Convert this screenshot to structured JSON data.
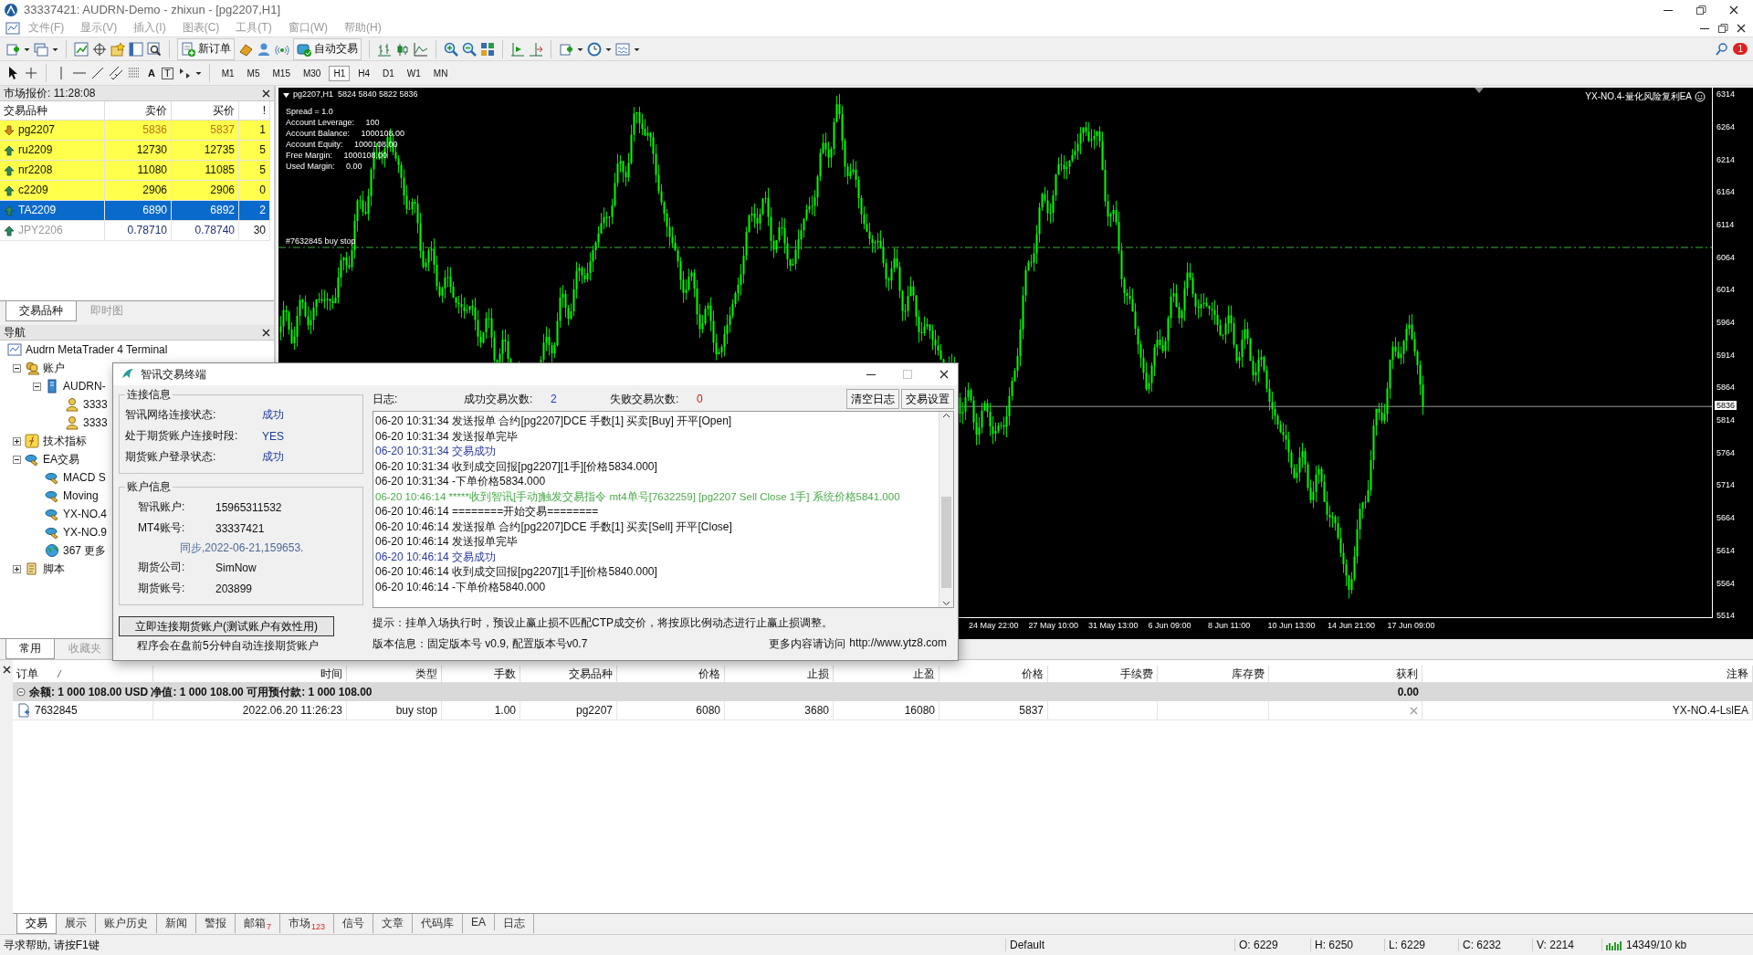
{
  "window": {
    "title": "33337421: AUDRN-Demo - zhixun - [pg2207,H1]"
  },
  "menu": [
    "文件(F)",
    "显示(V)",
    "插入(I)",
    "图表(C)",
    "工具(T)",
    "窗口(W)",
    "帮助(H)"
  ],
  "toolbar": {
    "new_order": "新订单",
    "auto_trade": "自动交易",
    "text_tool": "A",
    "label_tool": "T",
    "notifications": "1",
    "timeframes": [
      {
        "label": "M1",
        "selected": false
      },
      {
        "label": "M5",
        "selected": false
      },
      {
        "label": "M15",
        "selected": false
      },
      {
        "label": "M30",
        "selected": false
      },
      {
        "label": "H1",
        "selected": true
      },
      {
        "label": "H4",
        "selected": false
      },
      {
        "label": "D1",
        "selected": false
      },
      {
        "label": "W1",
        "selected": false
      },
      {
        "label": "MN",
        "selected": false
      }
    ]
  },
  "market_watch": {
    "title": "市场报价: 11:28:08",
    "columns": [
      "交易品种",
      "卖价",
      "买价",
      "!"
    ],
    "rows": [
      {
        "symbol": "pg2207",
        "bid": "5836",
        "ask": "5837",
        "spread": "1",
        "falling": true,
        "highlighted": true,
        "selected": false,
        "dimmed": false
      },
      {
        "symbol": "ru2209",
        "bid": "12730",
        "ask": "12735",
        "spread": "5",
        "falling": false,
        "highlighted": true,
        "selected": false,
        "dimmed": false
      },
      {
        "symbol": "nr2208",
        "bid": "11080",
        "ask": "11085",
        "spread": "5",
        "falling": false,
        "highlighted": true,
        "selected": false,
        "dimmed": false
      },
      {
        "symbol": "c2209",
        "bid": "2906",
        "ask": "2906",
        "spread": "0",
        "falling": false,
        "highlighted": true,
        "selected": false,
        "dimmed": false
      },
      {
        "symbol": "TA2209",
        "bid": "6890",
        "ask": "6892",
        "spread": "2",
        "falling": false,
        "highlighted": false,
        "selected": true,
        "dimmed": false
      },
      {
        "symbol": "JPY2206",
        "bid": "0.78710",
        "ask": "0.78740",
        "spread": "30",
        "falling": false,
        "highlighted": false,
        "selected": false,
        "dimmed": true
      }
    ],
    "tabs": [
      {
        "label": "交易品种",
        "selected": true
      },
      {
        "label": "即时图",
        "selected": false
      }
    ]
  },
  "navigator": {
    "title": "导航",
    "tree": {
      "label": "Audrn MetaTrader 4 Terminal",
      "kind": "terminal",
      "children": [
        {
          "label": "账户",
          "kind": "accounts",
          "expanded": true,
          "children": [
            {
              "label": "AUDRN-",
              "kind": "server",
              "expanded": true,
              "children": [
                {
                  "label": "3333",
                  "kind": "account"
                },
                {
                  "label": "3333",
                  "kind": "account"
                }
              ]
            }
          ]
        },
        {
          "label": "技术指标",
          "kind": "indicators",
          "expanded": false
        },
        {
          "label": "EA交易",
          "kind": "experts",
          "expanded": true,
          "children": [
            {
              "label": "MACD S",
              "kind": "expert"
            },
            {
              "label": "Moving",
              "kind": "expert"
            },
            {
              "label": "YX-NO.4",
              "kind": "expert"
            },
            {
              "label": "YX-NO.9",
              "kind": "expert"
            },
            {
              "label": "367 更多",
              "kind": "more"
            }
          ]
        },
        {
          "label": "脚本",
          "kind": "scripts",
          "expanded": false
        }
      ]
    },
    "tabs": [
      {
        "label": "常用",
        "selected": true
      },
      {
        "label": "收藏夹",
        "selected": false
      }
    ]
  },
  "chart": {
    "header": "pg2207,H1  5824 5840 5822 5836",
    "info_lines": [
      "Spread = 1.0",
      "Account Leverage:     100",
      "Account Balance:     1000108.00",
      "Account Equity:     1000108.00",
      "Free Margin:     1000108.00",
      "Used Margin:     0.00"
    ],
    "ea_label": "YX-NO.4-量化风险复利EA",
    "order_label": "#7632845 buy stop",
    "price_ticks": [
      "6314",
      "6264",
      "6214",
      "6164",
      "6114",
      "6064",
      "6014",
      "5964",
      "5914",
      "5864",
      "5814",
      "5764",
      "5714",
      "5664",
      "5614",
      "5564",
      "5514"
    ],
    "current_price": "5836",
    "time_labels": [
      "24 May 22:00",
      "27 May 10:00",
      "31 May 13:00",
      "6 Jun 09:00",
      "8 Jun 11:00",
      "10 Jun 13:00",
      "14 Jun 21:00",
      "17 Jun 09:00"
    ]
  },
  "dialog": {
    "title": "智讯交易终端",
    "connection": {
      "title": "连接信息",
      "rows": [
        {
          "label": "智讯网络连接状态:",
          "value": "成功"
        },
        {
          "label": "处于期货账户连接时段:",
          "value": "YES"
        },
        {
          "label": "期货账户登录状态:",
          "value": "成功"
        }
      ]
    },
    "account": {
      "title": "账户信息",
      "rows": [
        {
          "kind": "field",
          "label": "智讯账户:",
          "value": "15965311532"
        },
        {
          "kind": "field",
          "label": "MT4账号:",
          "value": "33337421"
        },
        {
          "kind": "note",
          "text": "同步,2022-06-21,159653."
        },
        {
          "kind": "field",
          "label": "期货公司:",
          "value": "SimNow"
        },
        {
          "kind": "field",
          "label": "期货账号:",
          "value": "203899"
        }
      ]
    },
    "connect_button": "立即连接期货账户(测试账户有效性用)",
    "auto_note": "程序会在盘前5分钟自动连接期货账户",
    "log_label": "日志:",
    "stats": [
      {
        "label": "成功交易次数:",
        "value": "2",
        "color": "#1a3ad0"
      },
      {
        "label": "失败交易次数:",
        "value": "0",
        "color": "#e01010"
      }
    ],
    "buttons": [
      "清空日志",
      "交易设置"
    ],
    "log": [
      {
        "kind": "normal",
        "text": "06-20 10:31:34 发送报单 合约[pg2207]DCE 手数[1] 买卖[Buy] 开平[Open]"
      },
      {
        "kind": "normal",
        "text": "06-20 10:31:34 发送报单完毕"
      },
      {
        "kind": "success",
        "text": "06-20 10:31:34 交易成功"
      },
      {
        "kind": "normal",
        "text": "06-20 10:31:34 收到成交回报[pg2207][1手][价格5834.000]"
      },
      {
        "kind": "normal",
        "text": "06-20 10:31:34 -下单价格5834.000"
      },
      {
        "kind": "signal",
        "text": "06-20 10:46:14 *****收到智讯[手动]触发交易指令 mt4单号[7632259] [pg2207 Sell Close 1手] 系统价格5841.000"
      },
      {
        "kind": "normal",
        "text": "06-20 10:46:14 ========开始交易========"
      },
      {
        "kind": "normal",
        "text": "06-20 10:46:14 发送报单 合约[pg2207]DCE 手数[1] 买卖[Sell] 开平[Close]"
      },
      {
        "kind": "normal",
        "text": "06-20 10:46:14 发送报单完毕"
      },
      {
        "kind": "success",
        "text": "06-20 10:46:14 交易成功"
      },
      {
        "kind": "normal",
        "text": "06-20 10:46:14 收到成交回报[pg2207][1手][价格5840.000]"
      },
      {
        "kind": "normal",
        "text": "06-20 10:46:14 -下单价格5840.000"
      }
    ],
    "hint": "提示：挂单入场执行时，预设止赢止损不匹配CTP成交价，将按原比例动态进行止赢止损调整。",
    "version": "版本信息：固定版本号 v0.9, 配置版本号v0.7",
    "more_label": "更多内容请访问",
    "link": "http://www.ytz8.com"
  },
  "terminal": {
    "columns": [
      "订单",
      "时间",
      "类型",
      "手数",
      "交易品种",
      "价格",
      "止损",
      "止盈",
      "价格",
      "手续费",
      "库存费",
      "获利",
      "注释"
    ],
    "balance": "余额: 1 000 108.00 USD  净值: 1 000 108.00  可用预付款: 1 000 108.00",
    "balance_profit": "0.00",
    "orders": [
      {
        "ticket": "7632845",
        "time": "2022.06.20 11:26:23",
        "type": "buy stop",
        "lots": "1.00",
        "symbol": "pg2207",
        "price": "6080",
        "sl": "3680",
        "tp": "16080",
        "current": "5837",
        "comment": "YX-NO.4-LslEA"
      }
    ],
    "tabs": [
      {
        "label": "交易",
        "selected": true
      },
      {
        "label": "展示",
        "selected": false
      },
      {
        "label": "账户历史",
        "selected": false
      },
      {
        "label": "新闻",
        "selected": false
      },
      {
        "label": "警报",
        "selected": false
      },
      {
        "label": "邮箱",
        "badge": "7",
        "selected": false
      },
      {
        "label": "市场",
        "badge": "123",
        "selected": false
      },
      {
        "label": "信号",
        "selected": false
      },
      {
        "label": "文章",
        "selected": false
      },
      {
        "label": "代码库",
        "selected": false
      },
      {
        "label": "EA",
        "selected": false
      },
      {
        "label": "日志",
        "selected": false
      }
    ]
  },
  "status_bar": {
    "help": "寻求帮助, 请按F1键",
    "profile": "Default",
    "ohlcv": [
      "O: 6229",
      "H: 6250",
      "L: 6229",
      "C: 6232",
      "V: 2214"
    ],
    "traffic": "14349/10 kb"
  }
}
